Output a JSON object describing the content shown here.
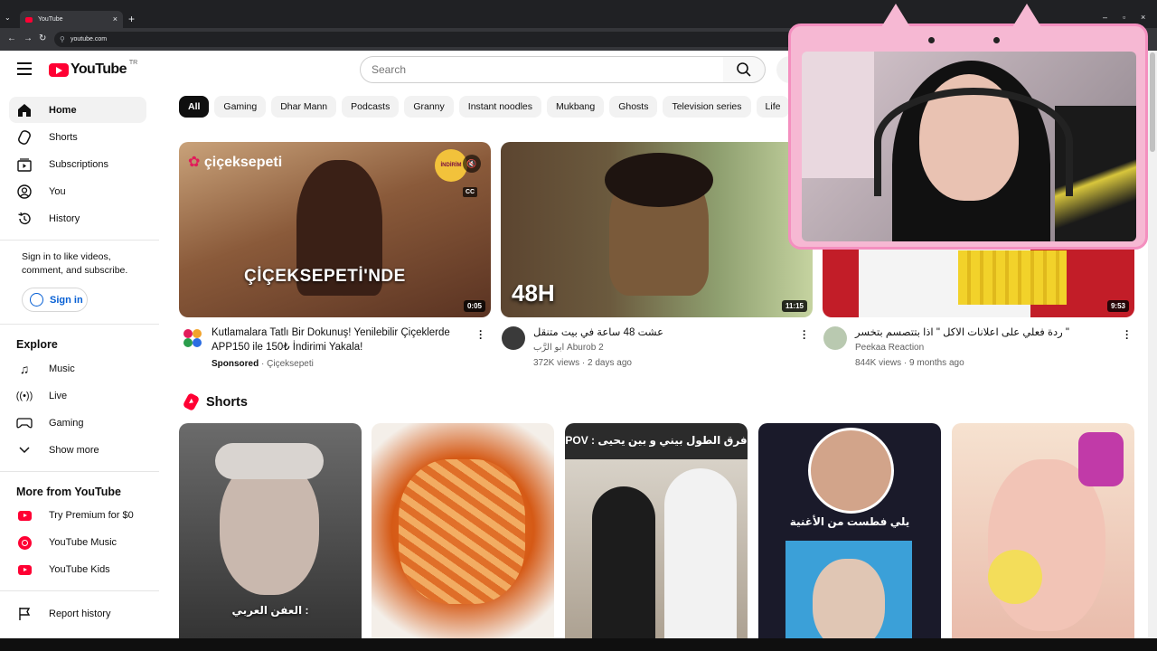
{
  "browser": {
    "tab_title": "YouTube",
    "url": "youtube.com"
  },
  "masthead": {
    "logo_text": "YouTube",
    "country_code": "TR",
    "search_placeholder": "Search"
  },
  "sidebar": {
    "main": [
      {
        "label": "Home",
        "icon": "home-icon",
        "active": true
      },
      {
        "label": "Shorts",
        "icon": "shorts-icon"
      },
      {
        "label": "Subscriptions",
        "icon": "subscriptions-icon"
      },
      {
        "label": "You",
        "icon": "you-icon"
      },
      {
        "label": "History",
        "icon": "history-icon"
      }
    ],
    "signin_prompt": "Sign in to like videos, comment, and subscribe.",
    "signin_label": "Sign in",
    "explore_heading": "Explore",
    "explore": [
      {
        "label": "Music",
        "icon": "music-icon"
      },
      {
        "label": "Live",
        "icon": "live-icon"
      },
      {
        "label": "Gaming",
        "icon": "gaming-icon"
      },
      {
        "label": "Show more",
        "icon": "chevron-down-icon"
      }
    ],
    "more_heading": "More from YouTube",
    "more": [
      {
        "label": "Try Premium for $0",
        "icon": "youtube-premium-icon"
      },
      {
        "label": "YouTube Music",
        "icon": "youtube-music-icon"
      },
      {
        "label": "YouTube Kids",
        "icon": "youtube-kids-icon"
      }
    ],
    "report_history": "Report history"
  },
  "chips": [
    "All",
    "Gaming",
    "Dhar Mann",
    "Podcasts",
    "Granny",
    "Instant noodles",
    "Mukbang",
    "Ghosts",
    "Television series",
    "Life"
  ],
  "videos": [
    {
      "title": "Kutlamalara Tatlı Bir Dokunuş! Yenilebilir Çiçeklerde APP150 ile 150₺ İndirimi Yakala!",
      "sponsored": "Sponsored",
      "channel": "Çiçeksepeti",
      "duration": "0:05",
      "thumb_text": "ÇİÇEKSEPETİ'NDE",
      "brand": "çiçeksepeti",
      "badge": "İNDİRİM",
      "cc": "CC"
    },
    {
      "title": "عشت 48 ساعة في بيت متنقل",
      "channel": "ابو الرَّب Aburob 2",
      "views": "372K views",
      "age": "2 days ago",
      "duration": "11:15",
      "thumb_text": "48H"
    },
    {
      "title": "ردة فعلي على اعلانات الاكل \" اذا بتتصسم بتخسر \"",
      "channel": "Peekaa Reaction",
      "views": "844K views",
      "age": "9 months ago",
      "duration": "9:53"
    }
  ],
  "shorts": {
    "heading": "Shorts",
    "items": [
      {
        "caption": "العفن العربي :"
      },
      {
        "caption": ""
      },
      {
        "caption": "POV : فرق الطول بيني و بين يحيى"
      },
      {
        "caption": "يلي فطست من الأغنية"
      },
      {
        "caption": ""
      }
    ]
  },
  "colors": {
    "accent": "#ff0033",
    "link": "#065fd4",
    "overlay_pink": "#f6b8d3"
  }
}
